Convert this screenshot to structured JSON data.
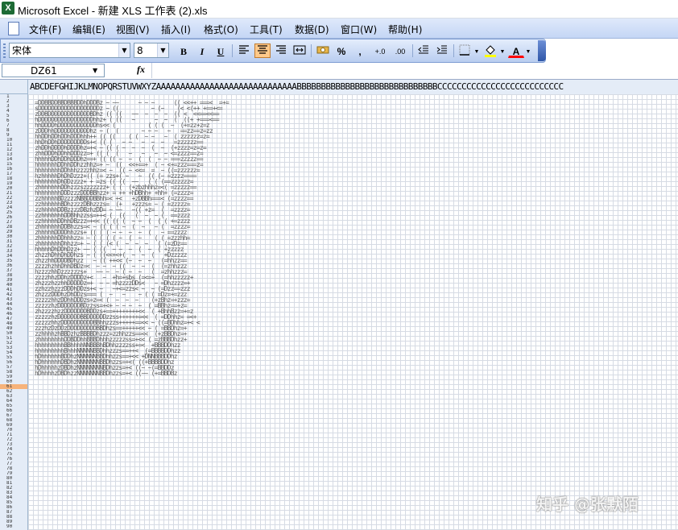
{
  "window": {
    "title": "Microsoft Excel - 新建 XLS 工作表 (2).xls"
  },
  "menu": {
    "items": [
      "文件(F)",
      "编辑(E)",
      "视图(V)",
      "插入(I)",
      "格式(O)",
      "工具(T)",
      "数据(D)",
      "窗口(W)",
      "帮助(H)"
    ]
  },
  "toolbar": {
    "font_name": "宋体",
    "font_size": "8",
    "bold": "B",
    "italic": "I",
    "underline": "U",
    "percent": "%",
    "comma": ",",
    "increase_decimal": "+.0",
    "decrease_decimal": ".00",
    "font_color_label": "A"
  },
  "formula_bar": {
    "name_box": "DZ61",
    "fx_label": "fx",
    "content": ""
  },
  "sheet": {
    "column_header_text": "ABCDEFGHIJKLMNOPQRSTUVWXYZAAAAAAAAAAAAAAAAAAAAAAAAAAAAABBBBBBBBBBBBBBBBBBBBBBBBBBBBBCCCCCCCCCCCCCCCCCCCCCCCCCC",
    "row_numbers": [
      "1",
      "2",
      "3",
      "4",
      "5",
      "6",
      "7",
      "8",
      "9",
      "10",
      "11",
      "12",
      "13",
      "14",
      "15",
      "16",
      "17",
      "18",
      "19",
      "20",
      "21",
      "22",
      "23",
      "24",
      "25",
      "26",
      "27",
      "28",
      "29",
      "30",
      "31",
      "32",
      "33",
      "34",
      "35",
      "36",
      "37",
      "38",
      "39",
      "40",
      "41",
      "42",
      "43",
      "44",
      "45",
      "46",
      "47",
      "48",
      "49",
      "50",
      "51",
      "52",
      "53",
      "54",
      "55",
      "56",
      "57",
      "58",
      "59",
      "60",
      "61",
      "62",
      "63",
      "64",
      "65",
      "66",
      "67",
      "68",
      "69",
      "70",
      "71",
      "72",
      "73",
      "74",
      "75",
      "76",
      "77",
      "78",
      "79",
      "80",
      "81",
      "82",
      "83",
      "84",
      "85",
      "86",
      "87",
      "88",
      "89",
      "90"
    ],
    "selected_row": "61",
    "ascii_art": [
      "=DDBBDDBBDBBBDDhDDDBz ~ ~~      ~ ~ ~      (( <<++ ===<  =+=",
      "sDDDDDDDDDDDDDDDDDDDz ~ ((          ~ (~    (< <(++ +==+<=",
      "zDDBDDDDDDDDDDDDDBDhz (( ((   ~~  ~  ~  ~  (( <  <<==<<==",
      "hDDDDDDDDDDDDDDDDDhhz+ ( ((   ~      ~  ~  (  ((+ +===<==",
      "hhDDDDhDDDDDDDDDDDDhs<< (          ( ( (  ~  (+=zz+z=z",
      "zDDDhhDDDDDDDDDDDhz ~ (  (       ~ ~ ~   ~   ==zz==z=zz",
      "hhDDhDDhDDhDDDhhh++ (( ((    ( (  ~ ~   ~  ( zzzzzz=z=",
      "hhDhDDhDDDDDDDDDs+< (( (   ~ ~   ~  ~  ~   =zzzzzz==",
      "zhDDhDDDDhDDDDhz=+< ~ (( ( ~  ~  ~  (  ~  (+zzzz=z=z=",
      "zhhDDDhDDhhDDDzz=+ (( (  (   ~   ~   ~  ~ <=zzzz==z=",
      "hhhhhDDhDDhDDDhz==+ (( (( ~  ~  (  (  ~ ~ ===zzzzz==",
      "hhhhhhhDDhhDDhzzhhz=+ ~  ((  <<+==+  ( ~ <+=zzz===z=",
      "hhhhhhhhDDhhhzzzzhhz=< ~  (( ~ <<=  =  ~ ((=zzzzzz=",
      "hzhhhhhDhDhDzzz+(( (= zzs+( ~   ~  (( (~ =zzzz====",
      "hhhhhhhDhDDzzzz+ + =zs (( ((  ~~   ( ( (==zzzzzz=",
      "zhhhhhhhDDhzzzszzzzzzz+ ( (  (+zbzhhhz=<( =zzzzz==",
      "hhhhhhhhDDDzzzDDDBBhzz+ = ++ +hDBhh+ +hh+ (=zzzz=",
      "zzhhhhhBDzzzzNBBDDBBhh=< +<   +zDBBh===< (=zzzz==",
      "zzhhhhhhBDhzzzzDBhzzzs=  (+   +zzzs= ~ ( =zzzzz=",
      "zzhhhhhDDBzzzzDBzhzDD= ~ ~~   ~(( +z=  (  =zzzz=",
      "zzhhhhhhhDDBhhzzss=++< (  ((   (  ~  ~ (  ==zzzz",
      "zzhhhhhDDhhDBzzz=+<< (( (( (  ~ ~  (  ( ( +=zzzz",
      "zhhhhhhhDDBhzzs=< ~ (( ( ( ~  (  ~   ~ (  =zzzz=",
      "zhhhhhDDDDhhzzs+ (( ( ( ~ ~  ~  ~  (   ~ ==zzzz",
      "zhhhhhhDDhhhzz= ~ ( ( ( ( ~  (  ~    ( ( =zzzhh=",
      "zhhhhhhhDhhzz=+ ~ ( ( (< (  ~  ~  ~   ( (=zDz==",
      "hhhhhDhDDhDzz+ ~~ ( ((  ~ ~  ~  (  ~  ( +zzzzz",
      "zhzzhDhhDhDDhzs ~ ( ((<<+<+(  ~  ~  (   +Dzzzzz",
      "zhzzhhDDDDBDhzz   ~ (( ++<< (~  ~  ~   (=hhzz==",
      "zzzzhzhhDhhDBDz=<  ~ ~  ~ ((  ~  ~  (  (=zhhzzz",
      "hzzzzhhDzzzzzzs+   ~~ ~  ~ ( ~  ~   (  =zhhzzz=",
      "zzzzhhzDDhzDDDDz+<   ~  +h=+sbs (=<=+  (=hhzzzzz+",
      "zhzzzhzzhhDDDDDz=+  ~ ~ =hzzzzDDs<   ~ =Dhzzzz=+",
      "zzhzzhzzzDDDhDDzs+< ~   ~+<=zzs< ~  ~ (=Dzz==zzz",
      "zhzzzDDDhzDhDDzs=== (  ~   ~    ~ ( ( =Dz=+=zzz",
      "zzzzzhhzDDhhDDDzs=z=< (  ~  ~  ~    (+zBhz=+zzz=",
      "zzzzzhzDDDDDDDBDzzss=+<+ ~ ~ ~  ~  ( =BBhz==+z=",
      "zhzzzzhzzDDDDDDDBDDzs+==++++++++<<  ( +BhhBzz=+=z",
      "zzzzzhzDDDDDDDBBDDDDDDzzss++++++=<<  ( =DDhhz= =<+",
      "zzzzzhhzDDDDDDDDDDBBhhzzzs+++++==<< ~ ((=BDhhz=+< <",
      "zzzhzDzDDzDDDDDDDDDBBDhzs==+++++<< ~ ( =BBDhz=+",
      "zzhhhhzhBBDzhzBBBBDhzzz=zzhhzzs==<<  (+zBBDhz=+",
      "zhhhhhhhhDDBDDhhBBBDhhhzzzzzss=+<< ( =zBBBDhzz+",
      "hhhhhhhhhBBhhhhNNBBBhBDhhzzzzss+=<  +BBBDDhzz",
      "hhhhhhhhhBhhhNNNNNBBDhhzzzs==++<  (=BBBBDDhzz",
      "hDhhhhhhBDDhzNNNNNNBBDhhzzs==+<< +DNNBBBDDhz",
      "hDhhhhhhDBDhzNNNNNNNBBDhzzs=+<( ((+BBBBDDhz",
      "hDhhhhhzDBDhzNNNNNNNNBDhzzs=+< ((~ ~(=BBDDz",
      "hDhhhhzDBDhzzNNNNNNNBBDhzzs=+< ((~~ (+=BBDBz"
    ],
    "watermark": "知乎 @张默陌"
  }
}
